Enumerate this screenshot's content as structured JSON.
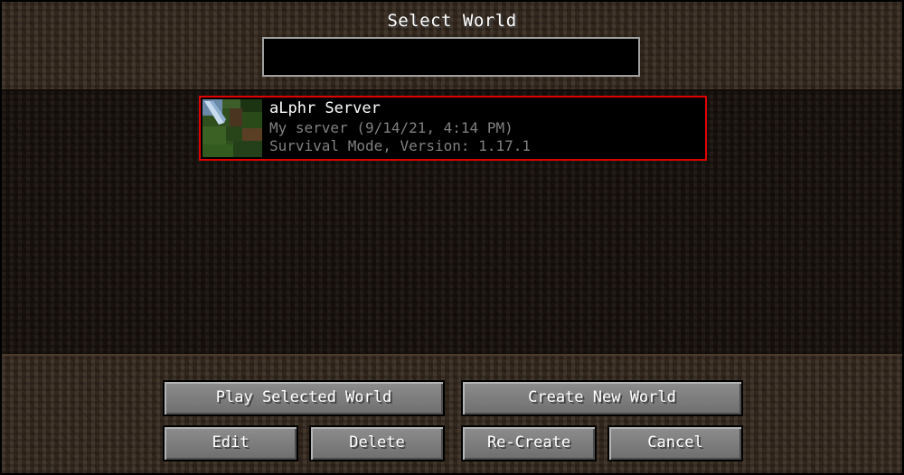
{
  "screen": {
    "title": "Select World",
    "search": {
      "value": "",
      "placeholder": ""
    }
  },
  "worlds": [
    {
      "name": "aLphr Server",
      "details": "My server (9/14/21, 4:14 PM)",
      "mode_version": "Survival Mode, Version: 1.17.1",
      "selected": true
    }
  ],
  "buttons": {
    "play": "Play Selected World",
    "create": "Create New World",
    "edit": "Edit",
    "delete": "Delete",
    "recreate": "Re-Create",
    "cancel": "Cancel"
  },
  "colors": {
    "selection_border": "#e00000",
    "title_text": "#ffffff",
    "secondary_text": "#808080"
  }
}
